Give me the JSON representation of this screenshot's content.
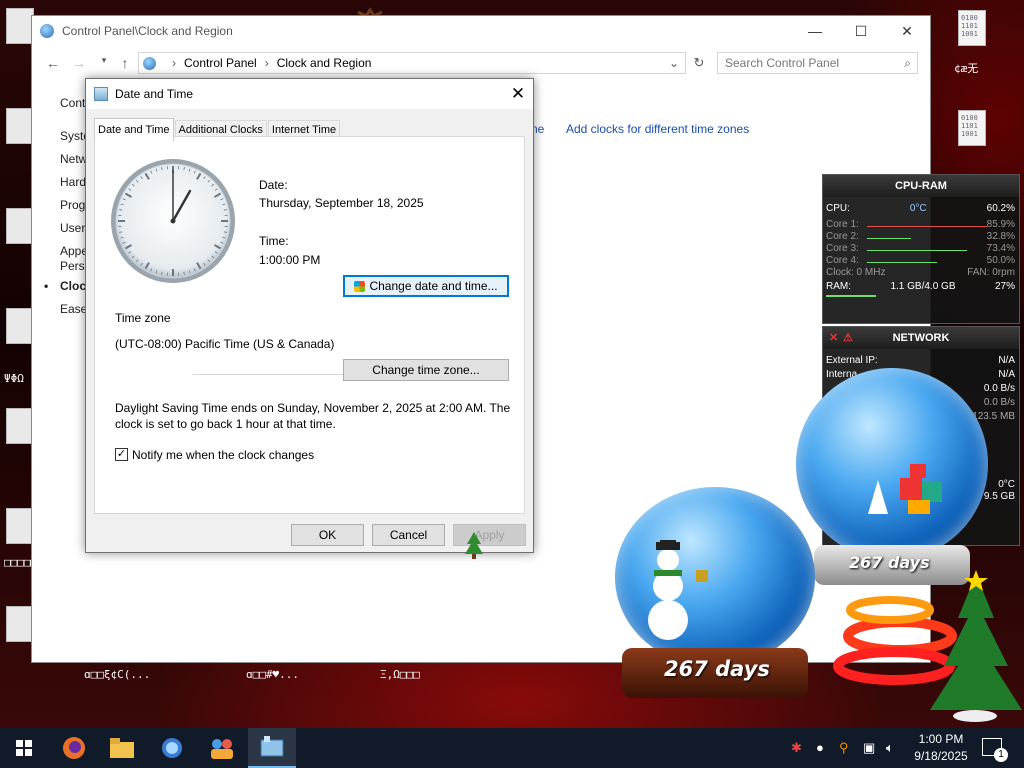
{
  "desktop": {
    "garble_texts": [
      "¢æ无",
      "ΨΦΩ",
      "ɑ□□ξ¢C(...",
      "ɑ□□#♥...",
      "Ξ,Ω□□□",
      "□□□□□□□"
    ],
    "bin_text": "0100 1101 1001"
  },
  "control_panel": {
    "title": "Control Panel\\Clock and Region",
    "breadcrumb": [
      "Control Panel",
      "Clock and Region"
    ],
    "search_placeholder": "Search Control Panel",
    "sidebar": [
      "Cont",
      "Syste",
      "Netw",
      "Hard",
      "Prog",
      "User",
      "Appe",
      "Perso",
      "Clock",
      "Ease"
    ],
    "active_sidebar_index": 8,
    "links": [
      "ne",
      "Add clocks for different time zones"
    ]
  },
  "dialog": {
    "title": "Date and Time",
    "tabs": [
      "Date and Time",
      "Additional Clocks",
      "Internet Time"
    ],
    "active_tab": 0,
    "date_label": "Date:",
    "date_value": "Thursday, September 18, 2025",
    "time_label": "Time:",
    "time_value": "1:00:00 PM",
    "change_datetime_button": "Change date and time...",
    "timezone_heading": "Time zone",
    "timezone_value": "(UTC-08:00) Pacific Time (US & Canada)",
    "change_timezone_button": "Change time zone...",
    "dst_line1": "Daylight Saving Time ends on Sunday, November 2, 2025 at 2:00 AM. The",
    "dst_line2": "clock is set to go back 1 hour at that time.",
    "notify_label": "Notify me when the clock changes",
    "notify_checked": true,
    "ok": "OK",
    "cancel": "Cancel",
    "apply": "Apply"
  },
  "cpu_gadget": {
    "title": "CPU-RAM",
    "cpu_label": "CPU:",
    "cpu_temp": "0°C",
    "cpu_value": "60.2%",
    "cores": [
      {
        "label": "Core 1:",
        "value": "85.9%"
      },
      {
        "label": "Core 2:",
        "value": "32.8%"
      },
      {
        "label": "Core 3:",
        "value": "73.4%"
      },
      {
        "label": "Core 4:",
        "value": "50.0%"
      }
    ],
    "clock": "Clock: 0 MHz",
    "fan": "FAN: 0rpm",
    "ram_label": "RAM:",
    "ram_value": "1.1 GB/4.0 GB",
    "ram_pct": "27%"
  },
  "network_gadget": {
    "title": "NETWORK",
    "external_ip_label": "External IP:",
    "external_ip_value": "N/A",
    "internal_label": "Interna",
    "internal_value": "N/A",
    "rates": [
      "0.0 B/s",
      "0.0 B/s",
      "123.5 MB"
    ],
    "temp": "0°C",
    "size": "9.5 GB"
  },
  "globes": {
    "days_small": "267 days",
    "days_large": "267 days"
  },
  "taskbar": {
    "time": "1:00 PM",
    "date": "9/18/2025",
    "notification_count": "1"
  }
}
